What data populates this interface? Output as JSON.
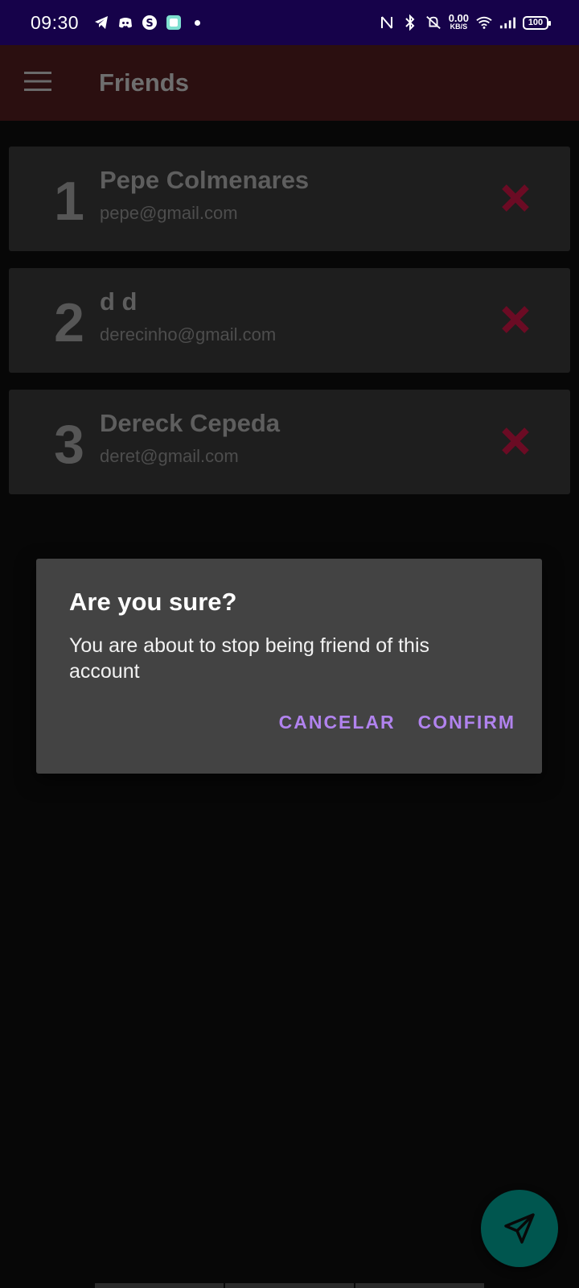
{
  "status_bar": {
    "time": "09:30",
    "speed_value": "0.00",
    "speed_unit": "KB/S",
    "battery": "100",
    "left_icons": [
      "telegram-icon",
      "discord-icon",
      "skype-icon",
      "app-icon"
    ],
    "right_icons": [
      "nfc-icon",
      "bluetooth-icon",
      "vibrate-off-icon",
      "wifi-icon",
      "signal-icon"
    ]
  },
  "app_bar": {
    "title": "Friends",
    "menu_icon": "hamburger-menu-icon"
  },
  "friends": [
    {
      "index": "1",
      "name": "Pepe Colmenares",
      "email": "pepe@gmail.com"
    },
    {
      "index": "2",
      "name": "d d",
      "email": "derecinho@gmail.com"
    },
    {
      "index": "3",
      "name": "Dereck Cepeda",
      "email": "deret@gmail.com"
    }
  ],
  "dialog": {
    "title": "Are you sure?",
    "message": "You are about to stop being friend of this account",
    "cancel_label": "CANCELAR",
    "confirm_label": "CONFIRM"
  },
  "fab": {
    "icon": "send-icon"
  },
  "colors": {
    "status_bar_bg": "#16024a",
    "app_bar_bg": "#2b0f10",
    "card_bg": "#1e1e1e",
    "remove_icon": "#6b0b24",
    "dialog_bg": "#434343",
    "dialog_accent": "#b183ee",
    "fab_bg": "#00564f"
  }
}
